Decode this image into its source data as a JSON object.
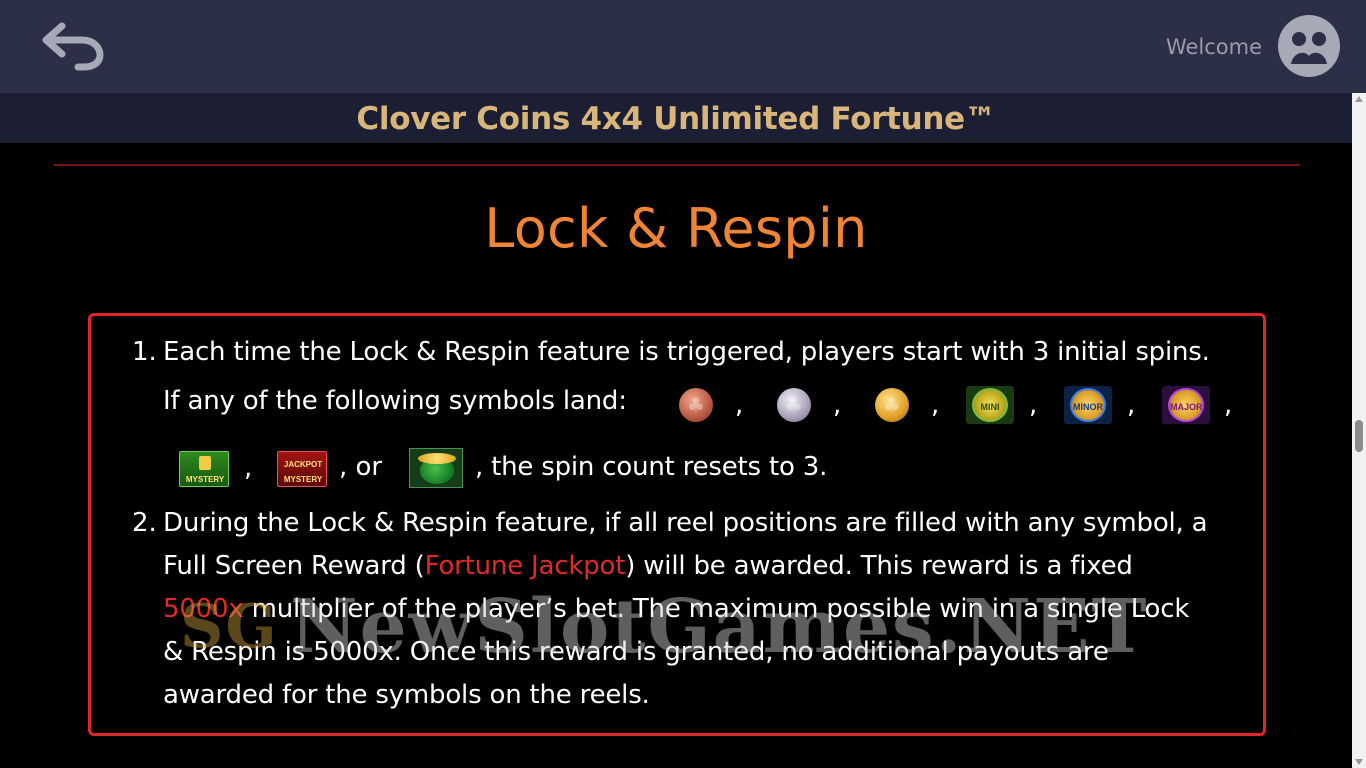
{
  "header": {
    "back_icon": "back-arrow-icon",
    "welcome_label": "Welcome",
    "avatar_icon": "user-avatar-icon"
  },
  "game": {
    "title": "Clover Coins 4x4 Unlimited Fortune™"
  },
  "section": {
    "title": "Lock & Respin"
  },
  "rules": {
    "rule1": {
      "number": "1.",
      "line1": "Each time the Lock & Respin feature is triggered, players start with 3 initial spins.",
      "line2": "If any of the following symbols land:",
      "comma": ",",
      "or_text": ", or",
      "tail": ", the spin count resets to 3.",
      "symbols": {
        "mini": "MINI",
        "minor": "MINOR",
        "major": "MAJOR",
        "mystery": "MYSTERY",
        "jackpot_mystery_1": "JACKPOT",
        "jackpot_mystery_2": "MYSTERY"
      }
    },
    "rule2": {
      "number": "2.",
      "line1": "During the Lock & Respin feature, if all reel positions are filled with any symbol, a",
      "line2_pre": "Full Screen Reward (",
      "line2_highlight": "Fortune Jackpot",
      "line2_post": ") will be awarded. This reward is a fixed",
      "line3_highlight": "5000x",
      "line3_post": " multiplier of the player’s bet. The maximum possible win in a single Lock",
      "line4": "& Respin is 5000x. Once this reward is granted, no additional payouts are",
      "line5": "awarded for the symbols on the reels."
    }
  },
  "watermark": {
    "text": "NewSlotGames.NET",
    "logo": "SG"
  },
  "colors": {
    "topbar": "#2b2f47",
    "titlebar": "#1c1e33",
    "title_gold": "#d8b57a",
    "section_orange": "#ef8434",
    "box_border": "#e2252c",
    "highlight_red": "#e02a2a"
  }
}
